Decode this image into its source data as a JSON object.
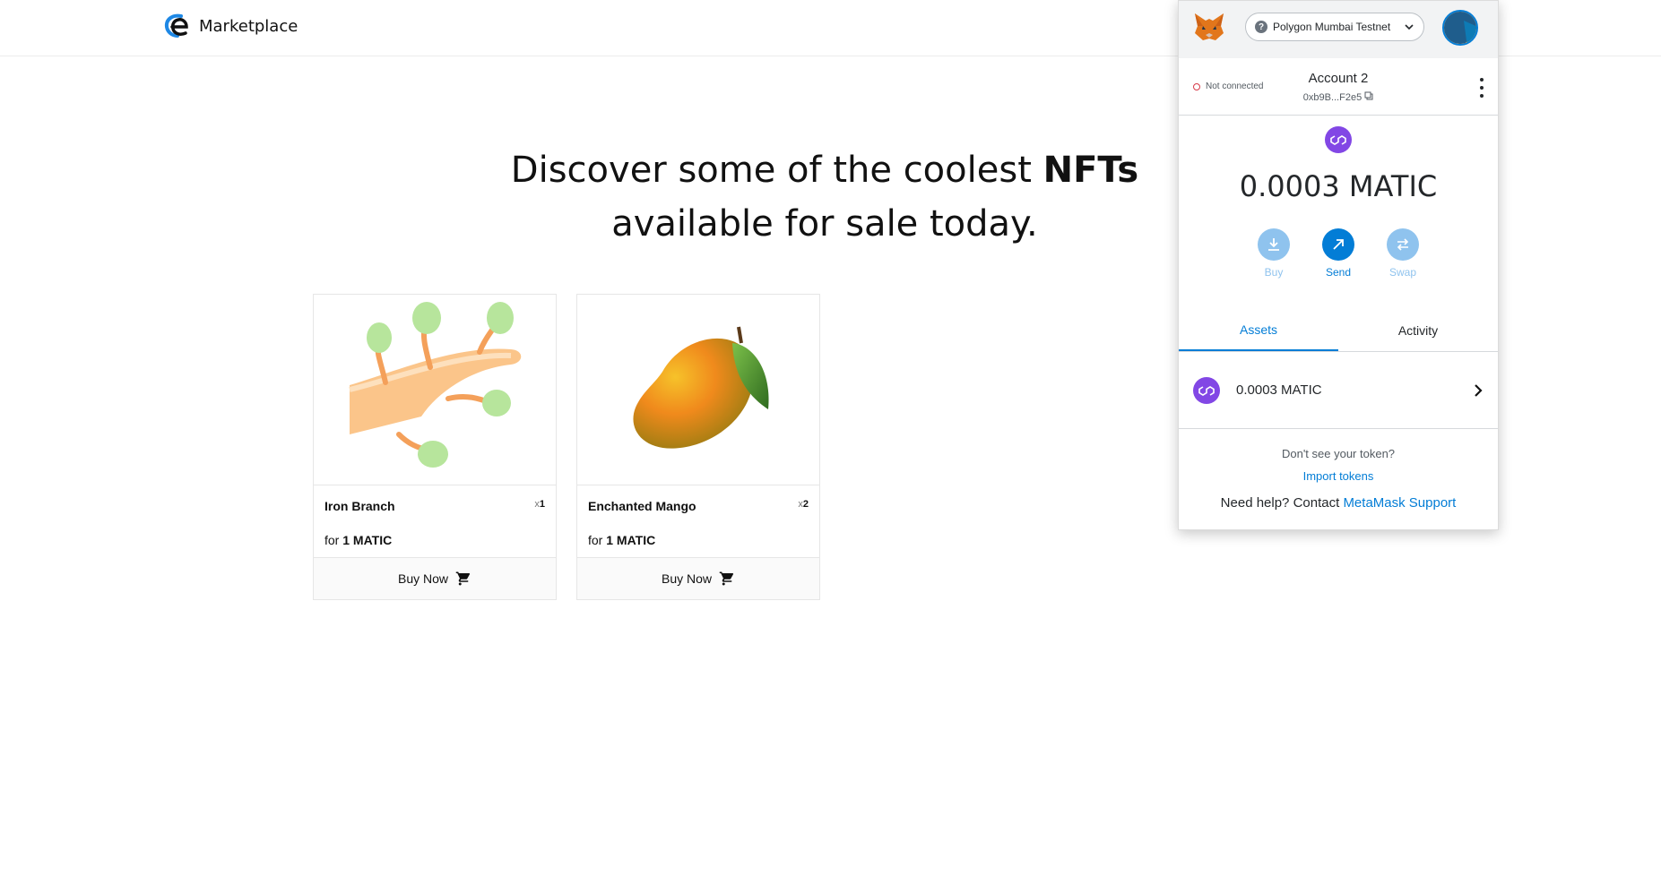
{
  "header": {
    "brand": "Marketplace"
  },
  "hero": {
    "line1_prefix": "Discover some of the coolest ",
    "line1_bold": "NFTs",
    "line2": "available for sale today."
  },
  "cards": [
    {
      "name": "Iron Branch",
      "qty_prefix": "x",
      "qty": "1",
      "price_prefix": "for ",
      "price": "1 MATIC",
      "button": "Buy Now"
    },
    {
      "name": "Enchanted Mango",
      "qty_prefix": "x",
      "qty": "2",
      "price_prefix": "for ",
      "price": "1 MATIC",
      "button": "Buy Now"
    }
  ],
  "metamask": {
    "network": "Polygon Mumbai Testnet",
    "network_badge": "?",
    "connection_status": "Not connected",
    "account_name": "Account 2",
    "account_address": "0xb9B...F2e5",
    "balance": "0.0003 MATIC",
    "actions": {
      "buy": "Buy",
      "send": "Send",
      "swap": "Swap"
    },
    "tabs": {
      "assets": "Assets",
      "activity": "Activity"
    },
    "asset_row": {
      "amount": "0.0003 MATIC"
    },
    "footer": {
      "dont_see": "Don't see your token?",
      "import": "Import tokens",
      "help_prefix": "Need help? Contact ",
      "help_link": "MetaMask Support"
    },
    "colors": {
      "accent": "#037dd6",
      "polygon": "#8247e5"
    }
  }
}
